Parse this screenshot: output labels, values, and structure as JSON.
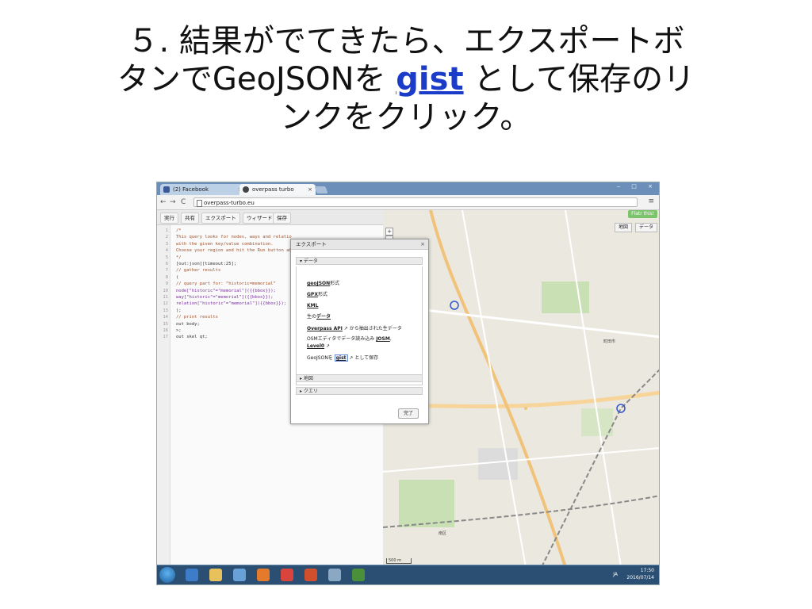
{
  "slide": {
    "title_line1": "５. 結果がでてきたら、エクスポートボ",
    "title_line2_pre": "タンでGeoJSONを ",
    "title_link": "gist",
    "title_line2_post": " として保存のリ",
    "title_line3": "ンクをクリック。"
  },
  "browser": {
    "tabs": [
      {
        "label": "(2) Facebook",
        "close": "×"
      },
      {
        "label": "overpass turbo",
        "close": "×"
      }
    ],
    "url": "overpass-turbo.eu",
    "back": "←",
    "forward": "→",
    "reload": "C",
    "menu": "≡",
    "window_controls": "‒ □ ×"
  },
  "toolbar": {
    "run": "実行",
    "share": "共有",
    "export": "エクスポート",
    "wizard": "ウィザード",
    "save": "保存"
  },
  "editor": {
    "lines": [
      {
        "n": "1",
        "t": "/*",
        "cls": "c-comment"
      },
      {
        "n": "2",
        "t": "This query looks for nodes, ways and relatio",
        "cls": "c-comment"
      },
      {
        "n": "3",
        "t": "with the given key/value combination.",
        "cls": "c-comment"
      },
      {
        "n": "4",
        "t": "Choose your region and hit the Run button abo",
        "cls": "c-comment"
      },
      {
        "n": "5",
        "t": "*/",
        "cls": "c-comment"
      },
      {
        "n": "6",
        "t": "[out:json][timeout:25];",
        "cls": "c-kw"
      },
      {
        "n": "7",
        "t": "// gather results",
        "cls": "c-comment"
      },
      {
        "n": "8",
        "t": "(",
        "cls": "c-kw"
      },
      {
        "n": "9",
        "t": "  // query part for: “historic=memorial”",
        "cls": "c-comment"
      },
      {
        "n": "10",
        "t": "  node[\"historic\"=\"memorial\"]({{bbox}});",
        "cls": "c-str"
      },
      {
        "n": "11",
        "t": "  way[\"historic\"=\"memorial\"]({{bbox}});",
        "cls": "c-str"
      },
      {
        "n": "12",
        "t": "  relation[\"historic\"=\"memorial\"]({{bbox}});",
        "cls": "c-str"
      },
      {
        "n": "13",
        "t": ");",
        "cls": "c-kw"
      },
      {
        "n": "14",
        "t": "// print results",
        "cls": "c-comment"
      },
      {
        "n": "15",
        "t": "out body;",
        "cls": "c-kw"
      },
      {
        "n": "16",
        "t": ">;",
        "cls": "c-kw"
      },
      {
        "n": "17",
        "t": "out skel qt;",
        "cls": "c-kw"
      }
    ]
  },
  "map": {
    "share_button": "Flatr this!",
    "tab_map": "地図",
    "tab_data": "データ",
    "zoom_in": "+",
    "zoom_out": "−",
    "scale": "500 m",
    "labels": [
      "町田市",
      "南区"
    ]
  },
  "dialog": {
    "title": "エクスポート",
    "close": "×",
    "section_data": "▾ データ",
    "section_map": "▸ 地図",
    "section_query": "▸ クエリ",
    "options": [
      {
        "bold": "geoJSON",
        "rest": "形式"
      },
      {
        "bold": "GPX",
        "rest": "形式"
      },
      {
        "bold": "KML",
        "rest": ""
      },
      {
        "pre": "生の",
        "bold": "データ",
        "rest": ""
      },
      {
        "bold": "Overpass API",
        "rest": " ↗ から抽出された生データ"
      },
      {
        "pre": "OSMエディタでデータ読み込み ",
        "bold": "JOSM",
        "rest": ","
      },
      {
        "bold": "Level0",
        "rest": " ↗"
      },
      {
        "pre": "GeoJSONを ",
        "bold": "gist",
        "rest": " ↗ として保存"
      }
    ],
    "done": "完了"
  },
  "taskbar": {
    "time": "17:50",
    "date": "2016/07/14",
    "lang": "JA"
  }
}
